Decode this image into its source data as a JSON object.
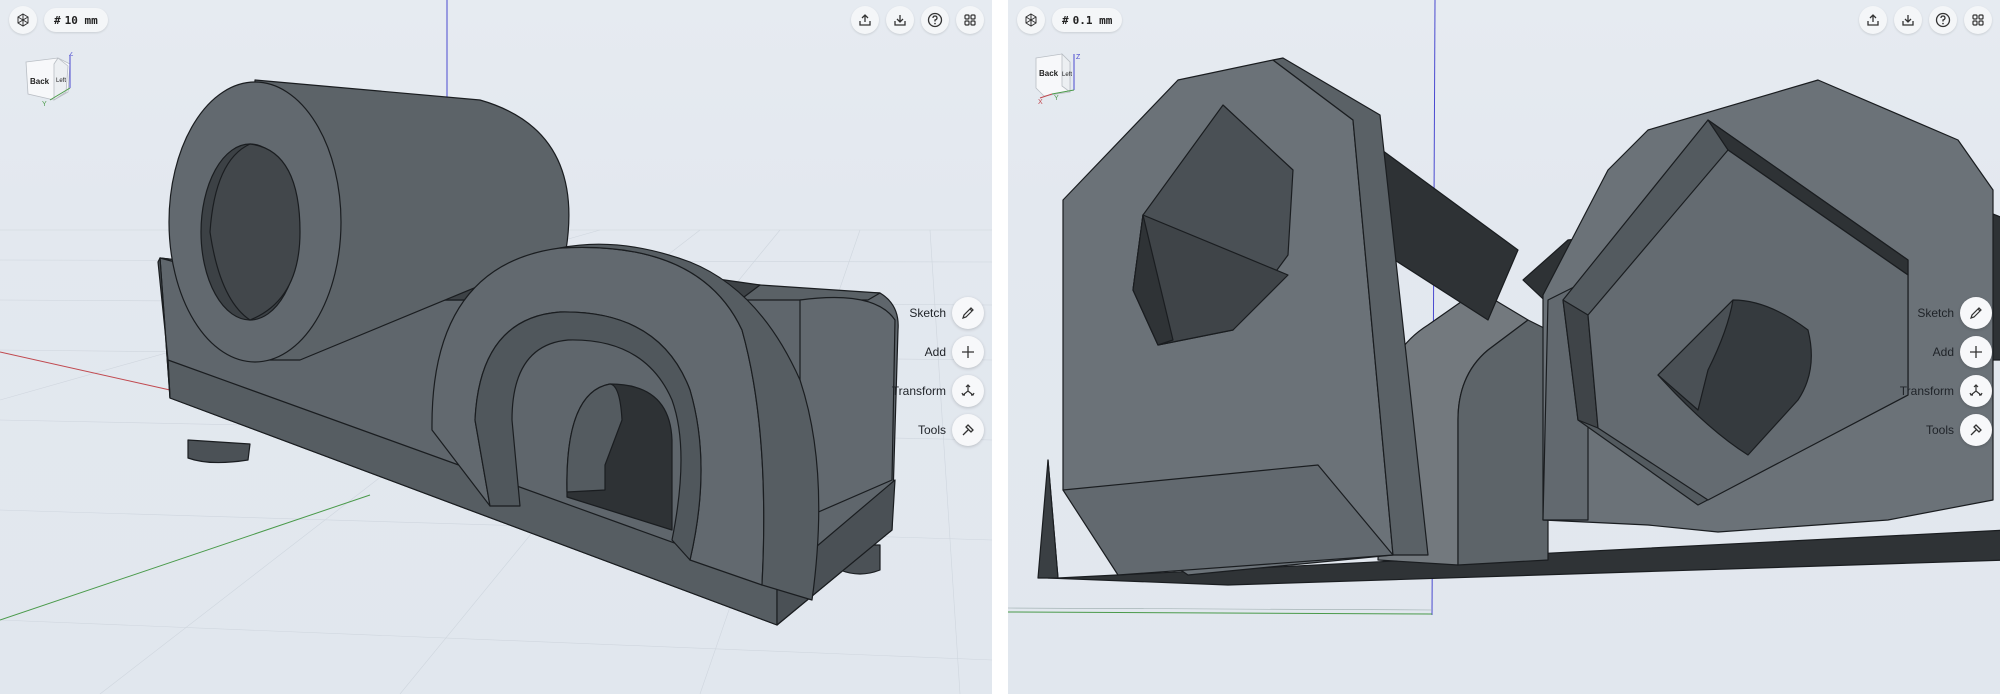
{
  "left_view": {
    "grid_label": "10 mm",
    "grid_icon": "hash-icon",
    "cube": {
      "face_front": "Back",
      "face_side": "Left",
      "axis_top": "Z",
      "axis_bottom": "Y"
    },
    "tools": [
      {
        "label": "Sketch",
        "icon": "pencil-icon"
      },
      {
        "label": "Add",
        "icon": "plus-icon"
      },
      {
        "label": "Transform",
        "icon": "move-arrows-icon"
      },
      {
        "label": "Tools",
        "icon": "hammer-icon"
      }
    ],
    "top_icons": [
      "export-icon",
      "download-icon",
      "help-icon",
      "grid-view-icon"
    ]
  },
  "right_view": {
    "grid_label": "0.1 mm",
    "grid_icon": "hash-icon",
    "cube": {
      "face_front": "Back",
      "face_side": "Left",
      "axis_top": "Z",
      "axis_bottom": "Y",
      "axis_left": "X"
    },
    "tools": [
      {
        "label": "Sketch",
        "icon": "pencil-icon"
      },
      {
        "label": "Add",
        "icon": "plus-icon"
      },
      {
        "label": "Transform",
        "icon": "move-arrows-icon"
      },
      {
        "label": "Tools",
        "icon": "hammer-icon"
      }
    ],
    "top_icons": [
      "export-icon",
      "download-icon",
      "help-icon",
      "grid-view-icon"
    ]
  },
  "colors": {
    "background": "#e3e8ef",
    "model_face": "#5f666c",
    "model_dark": "#3a3f43",
    "model_light": "#6b7278",
    "axis_x": "#c0494f",
    "axis_y": "#4a9a4a",
    "axis_z": "#4a4ad0"
  }
}
